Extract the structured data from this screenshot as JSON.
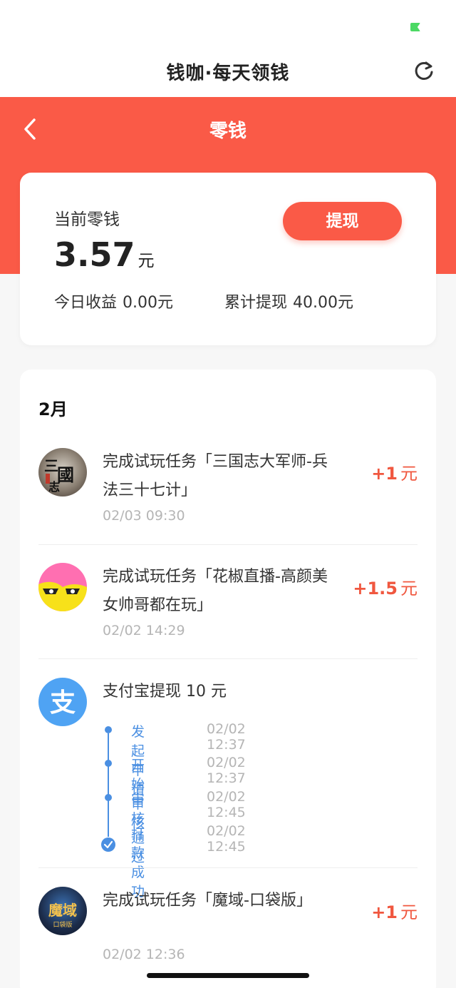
{
  "app": {
    "title": "钱咖·每天领钱"
  },
  "header": {
    "title": "零钱"
  },
  "balance": {
    "label": "当前零钱",
    "amount": "3.57",
    "unit": "元",
    "withdraw_button": "提现",
    "today_label": "今日收益",
    "today_value": "0.00元",
    "total_label": "累计提现",
    "total_value": "40.00元"
  },
  "records": {
    "month": "2月",
    "items": [
      {
        "title": "完成试玩任务「三国志大军师-兵法三十七计」",
        "time": "02/03 09:30",
        "amount": "+1",
        "unit": "元",
        "icon": "sanguozhi-game-icon"
      },
      {
        "title": "完成试玩任务「花椒直播-高颜美女帅哥都在玩」",
        "time": "02/02 14:29",
        "amount": "+1.5",
        "unit": "元",
        "icon": "huajiao-live-icon"
      },
      {
        "title": "支付宝提现 10 元",
        "icon": "alipay-icon",
        "steps": [
          {
            "label": "发起申请",
            "time": "02/02 12:37"
          },
          {
            "label": "开始审核",
            "time": "02/02 12:37"
          },
          {
            "label": "审核通过",
            "time": "02/02 12:45"
          },
          {
            "label": "打款成功",
            "time": "02/02 12:45"
          }
        ]
      },
      {
        "title": "完成试玩任务「魔域-口袋版」",
        "time": "02/02 12:36",
        "amount": "+1",
        "unit": "元",
        "icon": "moyu-game-icon"
      }
    ]
  },
  "colors": {
    "brand": "#fa5a47",
    "accent_blue": "#4a8fe2",
    "amount_red": "#f0573f"
  }
}
